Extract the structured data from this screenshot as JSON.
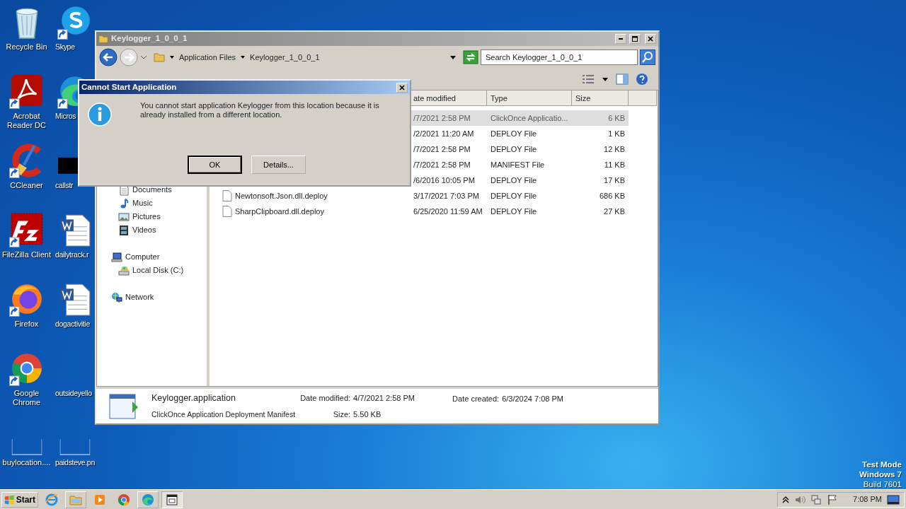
{
  "desktop": {
    "icons": [
      {
        "label": "Recycle Bin",
        "kind": "recycle-bin",
        "shortcut": false
      },
      {
        "label": "Acrobat Reader DC",
        "kind": "acrobat",
        "shortcut": true
      },
      {
        "label": "CCleaner",
        "kind": "ccleaner",
        "shortcut": true
      },
      {
        "label": "FileZilla Client",
        "kind": "filezilla",
        "shortcut": true
      },
      {
        "label": "Firefox",
        "kind": "firefox",
        "shortcut": true
      },
      {
        "label": "Google Chrome",
        "kind": "chrome",
        "shortcut": true
      },
      {
        "label": "buylocation....",
        "kind": "blank",
        "shortcut": false
      },
      {
        "label": "Skype",
        "kind": "skype",
        "shortcut": true
      },
      {
        "label": "Micros",
        "kind": "edge",
        "shortcut": true
      },
      {
        "label": "callstr",
        "kind": "black",
        "shortcut": false
      },
      {
        "label": "dailytrack.r",
        "kind": "word",
        "shortcut": false
      },
      {
        "label": "dogactivitie",
        "kind": "word",
        "shortcut": false
      },
      {
        "label": "outsideyello",
        "kind": "empty",
        "shortcut": false
      },
      {
        "label": "paidsteve.pn",
        "kind": "blank",
        "shortcut": false
      }
    ],
    "notice": [
      {
        "text": "Test Mode",
        "bold": true
      },
      {
        "text": "Windows 7",
        "bold": true
      },
      {
        "text": "Build 7601",
        "bold": false
      }
    ]
  },
  "explorer": {
    "title": "Keylogger_1_0_0_1",
    "crumbs": [
      "Application Files",
      "Keylogger_1_0_0_1"
    ],
    "search": {
      "placeholder": "Search Keylogger_1_0_0_1"
    },
    "columns": [
      "ate modified",
      "Type",
      "Size"
    ],
    "nav": [
      {
        "children": [
          {
            "label": "Documents",
            "kind": "documents"
          },
          {
            "label": "Music",
            "kind": "music"
          },
          {
            "label": "Pictures",
            "kind": "pictures"
          },
          {
            "label": "Videos",
            "kind": "videos"
          }
        ]
      },
      {
        "label": "Computer",
        "kind": "computer",
        "children": [
          {
            "label": "Local Disk (C:)",
            "kind": "disk"
          }
        ]
      },
      {
        "label": "Network",
        "kind": "network"
      }
    ],
    "files": [
      {
        "date": "/7/2021 2:58 PM",
        "type": "ClickOnce Applicatio...",
        "size": "6 KB",
        "selected": true
      },
      {
        "date": "/2/2021 11:20 AM",
        "type": "DEPLOY File",
        "size": "1 KB",
        "selected": false
      },
      {
        "date": "/7/2021 2:58 PM",
        "type": "DEPLOY File",
        "size": "12 KB",
        "selected": false
      },
      {
        "date": "/7/2021 2:58 PM",
        "type": "MANIFEST File",
        "size": "11 KB",
        "selected": false
      },
      {
        "date": "/6/2016 10:05 PM",
        "type": "DEPLOY File",
        "size": "17 KB",
        "selected": false
      },
      {
        "name": "Newtonsoft.Json.dll.deploy",
        "date": "3/17/2021 7:03 PM",
        "type": "DEPLOY File",
        "size": "686 KB",
        "selected": false
      },
      {
        "name": "SharpClipboard.dll.deploy",
        "date": "6/25/2020 11:59 AM",
        "type": "DEPLOY File",
        "size": "27 KB",
        "selected": false
      }
    ],
    "details": {
      "name": "Keylogger.application",
      "type": "ClickOnce Application Deployment Manifest",
      "modified": {
        "label": "Date modified:",
        "value": "4/7/2021 2:58 PM"
      },
      "size": {
        "label": "Size:",
        "value": "5.50 KB"
      },
      "created": {
        "label": "Date created:",
        "value": "6/3/2024 7:08 PM"
      }
    }
  },
  "dialog": {
    "title": "Cannot Start Application",
    "message": "You cannot start application Keylogger from this location because it is already installed from a different location.",
    "buttons": [
      {
        "label": "OK",
        "default": true
      },
      {
        "label": "Details...",
        "default": false
      }
    ]
  },
  "taskbar": {
    "start": "Start",
    "items": [
      {
        "kind": "ie",
        "running": false,
        "selected": false
      },
      {
        "kind": "explorer",
        "running": true,
        "selected": false
      },
      {
        "kind": "media",
        "running": false,
        "selected": false
      },
      {
        "kind": "chrome",
        "running": false,
        "selected": false
      },
      {
        "kind": "edge",
        "running": true,
        "selected": false
      },
      {
        "kind": "app",
        "running": true,
        "selected": true
      }
    ],
    "clock": "7:08 PM"
  }
}
